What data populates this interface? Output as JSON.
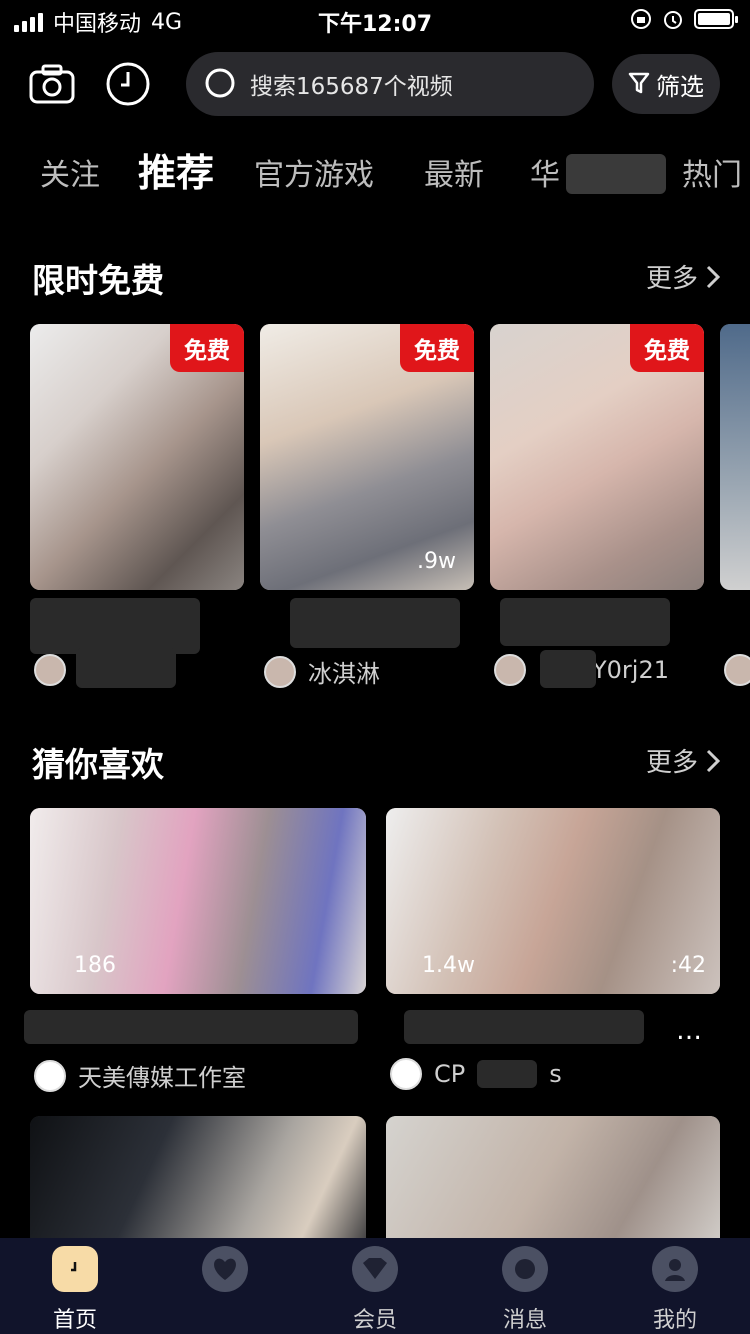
{
  "status_bar": {
    "carrier": "中国移动",
    "network": "4G",
    "time": "下午12:07"
  },
  "header": {
    "search_placeholder": "搜索165687个视频",
    "filter_label": "筛选"
  },
  "tabs": [
    {
      "label": "关注",
      "active": false
    },
    {
      "label": "推荐",
      "active": true
    },
    {
      "label": "官方游戏",
      "active": false
    },
    {
      "label": "最新",
      "active": false
    },
    {
      "label": "华",
      "active": false
    },
    {
      "label": "热门",
      "active": false
    }
  ],
  "limited_free": {
    "title": "限时免费",
    "more": "更多",
    "badge": "免费",
    "cards": [
      {
        "author": "",
        "stat_left": "",
        "stat_right": ""
      },
      {
        "author": "冰淇淋",
        "stat_left": "",
        "stat_right": ".9w"
      },
      {
        "author": "Y0rj21",
        "stat_left": "",
        "stat_right": ""
      }
    ]
  },
  "guess_you_like": {
    "title": "猜你喜欢",
    "more": "更多",
    "cards": [
      {
        "author": "天美傳媒工作室",
        "stat_left": "186",
        "stat_right": ""
      },
      {
        "author": "CP",
        "author_suffix": "s",
        "stat_left": "1.4w",
        "stat_right": ":42"
      }
    ]
  },
  "bottom_nav": [
    {
      "label": "首页",
      "active": true
    },
    {
      "label": "",
      "active": false
    },
    {
      "label": "会员",
      "active": false
    },
    {
      "label": "消息",
      "active": false
    },
    {
      "label": "我的",
      "active": false
    }
  ],
  "colors": {
    "accent_red": "#e0161a",
    "nav_bg": "#11142b",
    "search_bg": "#2a2a2e"
  }
}
